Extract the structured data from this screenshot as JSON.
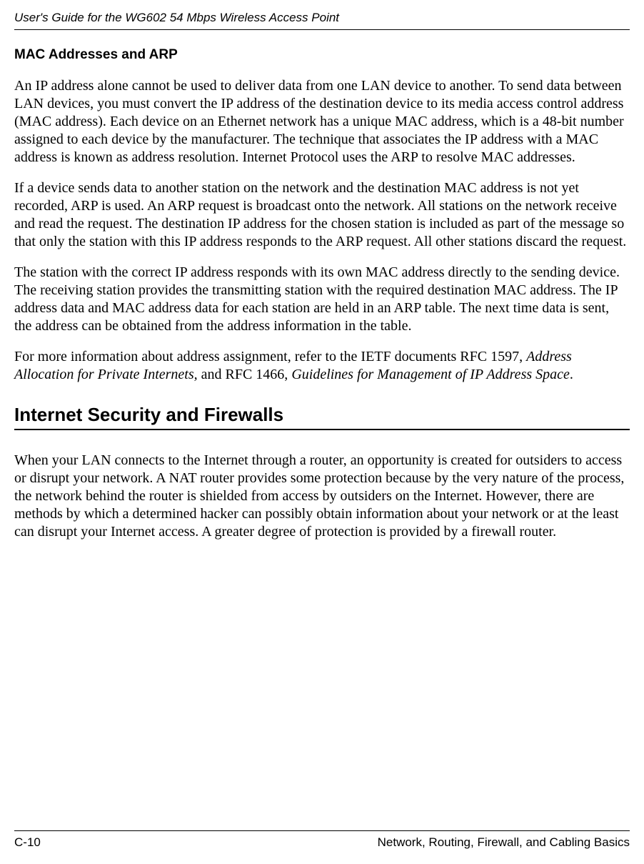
{
  "header": {
    "title": "User's Guide for the WG602 54 Mbps Wireless Access Point"
  },
  "section1": {
    "heading": "MAC Addresses and ARP",
    "p1": "An IP address alone cannot be used to deliver data from one LAN device to another. To send data between LAN devices, you must convert the IP address of the destination device to its media access control address (MAC address). Each device on an Ethernet network has a unique MAC address, which is a 48-bit number assigned to each device by the manufacturer. The technique that associates the IP address with a MAC address is known as address resolution. Internet Protocol uses the ARP to resolve MAC addresses.",
    "p2": "If a device sends data to another station on the network and the destination MAC address is not yet recorded, ARP is used. An ARP request is broadcast onto the network. All stations on the network receive and read the request. The destination IP address for the chosen station is included as part of the message so that only the station with this IP address responds to the ARP request. All other stations discard the request.",
    "p3": "The station with the correct IP address responds with its own MAC address directly to the sending device. The receiving station provides the transmitting station with the required destination MAC address. The IP address data and MAC address data for each station are held in an ARP table. The next time data is sent, the address can be obtained from the address information in the table.",
    "p4_pre": "For more information about address assignment, refer to the IETF documents RFC 1597, ",
    "p4_em1": "Address Allocation for Private Internets,",
    "p4_mid": " and RFC 1466, ",
    "p4_em2": "Guidelines for Management of IP Address Space",
    "p4_end": "."
  },
  "section2": {
    "heading": "Internet Security and Firewalls",
    "p1": "When your LAN connects to the Internet through a router, an opportunity is created for outsiders to access or disrupt your network. A NAT router provides some protection because by the very nature of the process, the network behind the router is shielded from access by outsiders on the Internet. However, there are methods by which a determined hacker can possibly obtain information about your network or at the least can disrupt your Internet access. A greater degree of protection is provided by a firewall router."
  },
  "footer": {
    "page_number": "C-10",
    "section_name": "Network, Routing, Firewall, and Cabling Basics"
  }
}
